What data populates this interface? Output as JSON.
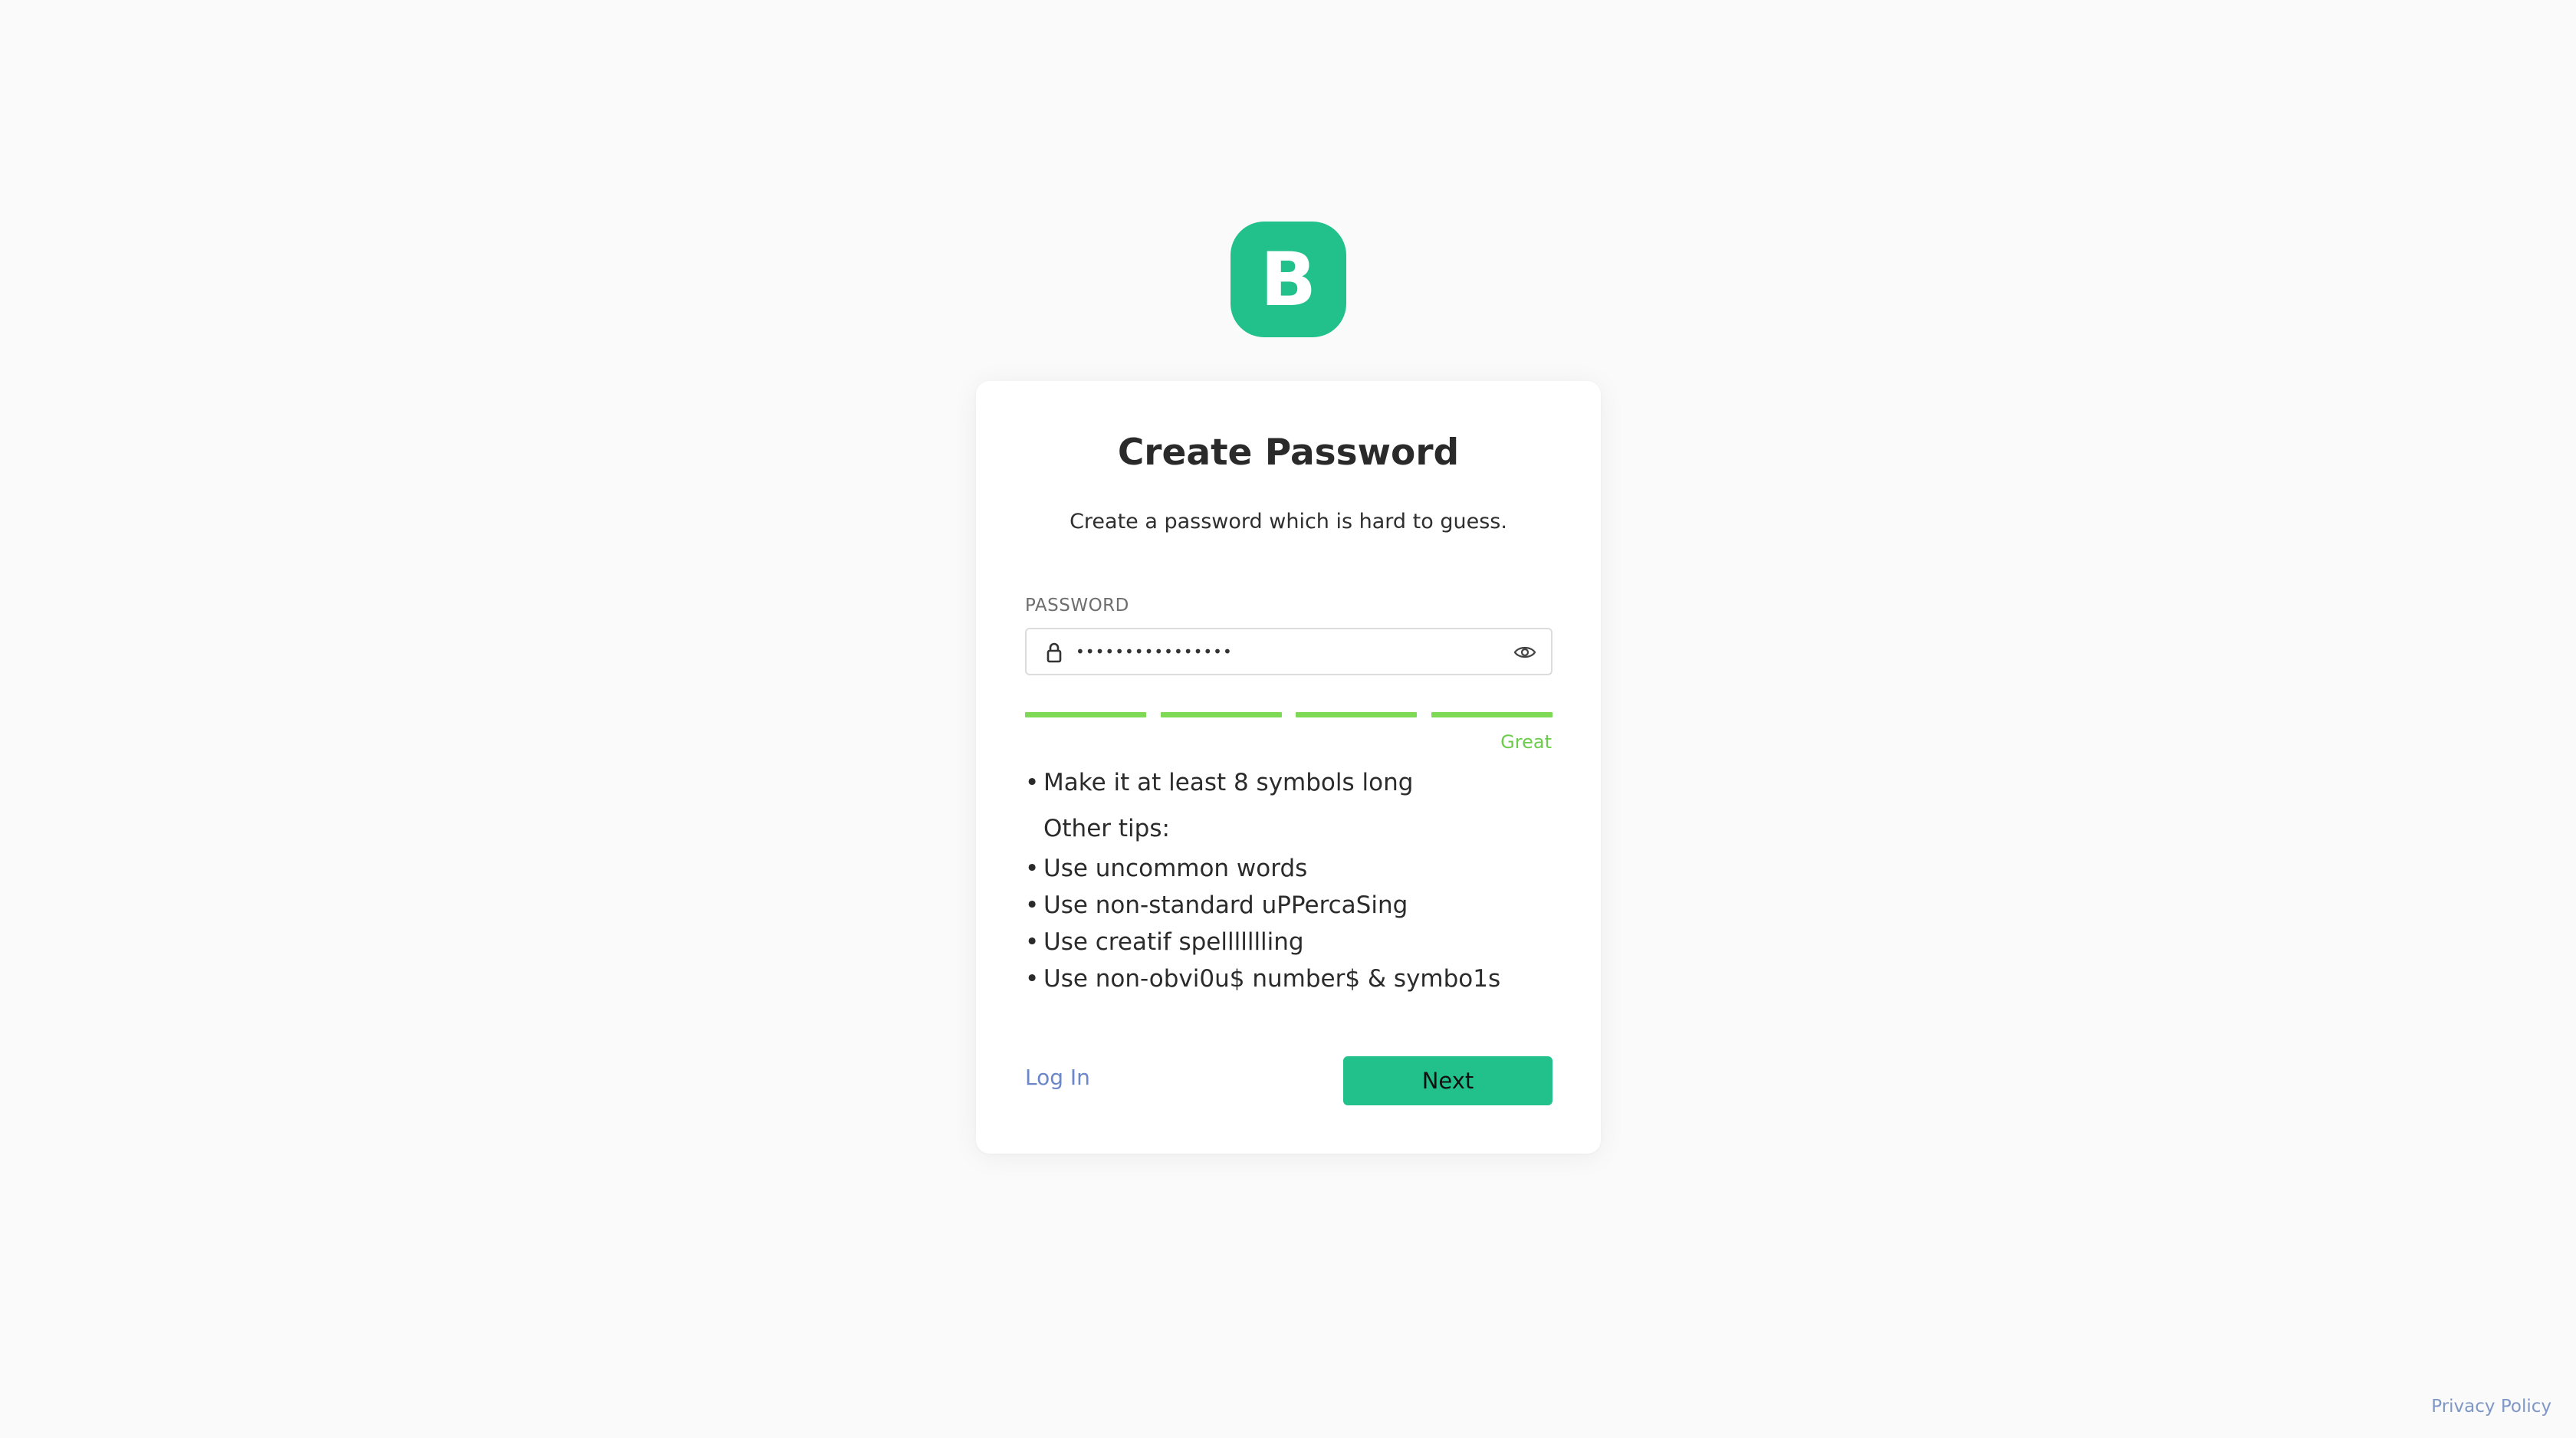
{
  "logo": {
    "letter": "B",
    "color": "#22c08b"
  },
  "card": {
    "title": "Create Password",
    "subtitle": "Create a password which is hard to guess."
  },
  "password_field": {
    "label": "PASSWORD",
    "value": "••••••••••••••••",
    "lock_icon": "lock-icon",
    "toggle_icon": "eye-icon"
  },
  "strength": {
    "segments_total": 4,
    "segments_filled": 4,
    "label": "Great",
    "color": "#7ed957"
  },
  "tips": {
    "main": "Make it at least 8 symbols long",
    "other_heading": "Other tips:",
    "items": [
      "Use uncommon words",
      "Use non-standard uPPercaSing",
      "Use creatif spellllllling",
      "Use non-obvi0u$ number$ & symbo1s"
    ]
  },
  "actions": {
    "login_label": "Log In",
    "next_label": "Next"
  },
  "footer": {
    "privacy_label": "Privacy Policy"
  }
}
